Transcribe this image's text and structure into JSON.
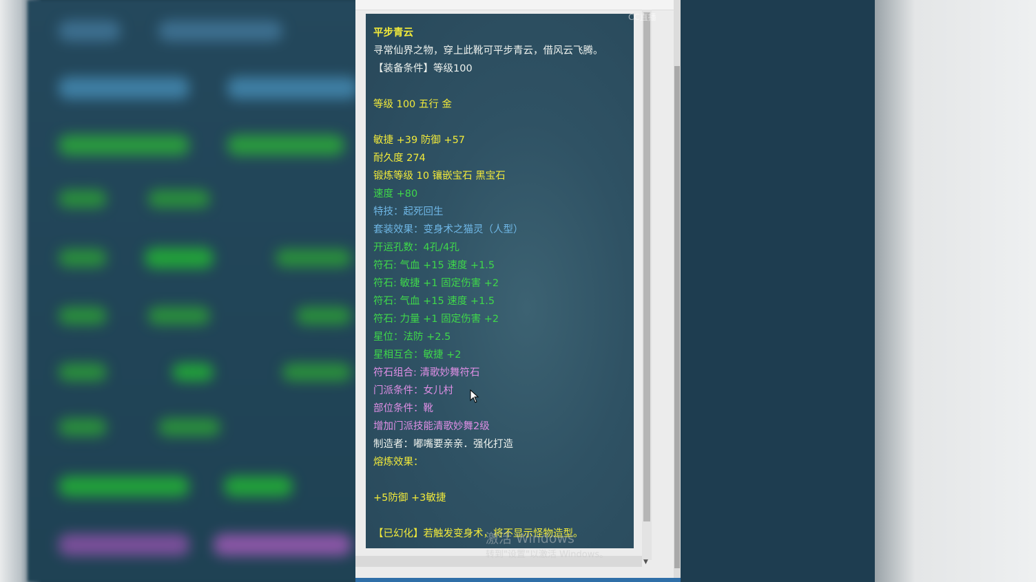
{
  "tooltip": {
    "name": "平步青云",
    "description": "寻常仙界之物，穿上此靴可平步青云，借风云飞腾。",
    "equip_requirement": "【装备条件】等级100",
    "level_element": "等级 100 五行 金",
    "stats": "敏捷 +39 防御 +57",
    "durability": "耐久度 274",
    "forge": "锻炼等级 10 镶嵌宝石 黑宝石",
    "speed": "速度 +80",
    "special_skill": "特技：起死回生",
    "set_effect": "套装效果：变身术之猫灵（人型）",
    "fortune_slots": "开运孔数：4孔/4孔",
    "runes": [
      "符石: 气血 +15 速度 +1.5",
      "符石: 敏捷 +1 固定伤害 +2",
      "符石: 气血 +15 速度 +1.5",
      "符石: 力量 +1 固定伤害 +2"
    ],
    "star_position": "星位：法防 +2.5",
    "star_harmony": "星相互合：敏捷 +2",
    "rune_combo": "符石组合: 清歌妙舞符石",
    "school_condition": "门派条件：女儿村",
    "slot_condition": "部位条件：靴",
    "school_skill_bonus": "增加门派技能清歌妙舞2级",
    "maker": "制造者：嘟嘴要亲亲．强化打造",
    "smelting_label": "熔炼效果：",
    "smelting_value": "+5防御 +3敏捷",
    "transform_note": "【已幻化】若触发变身术，将不显示怪物造型。"
  },
  "watermark": {
    "logo": "CC直播",
    "windows_line1": "激活 Windows",
    "windows_line2": "转到\"设置\"以激活 Windows。"
  },
  "colors": {
    "yellow": "#f2ea3a",
    "white": "#eef2ee",
    "green": "#3fd84a",
    "blue": "#6fb7e6",
    "pink": "#e08fe6",
    "tooltip_bg": "#2f5264"
  }
}
